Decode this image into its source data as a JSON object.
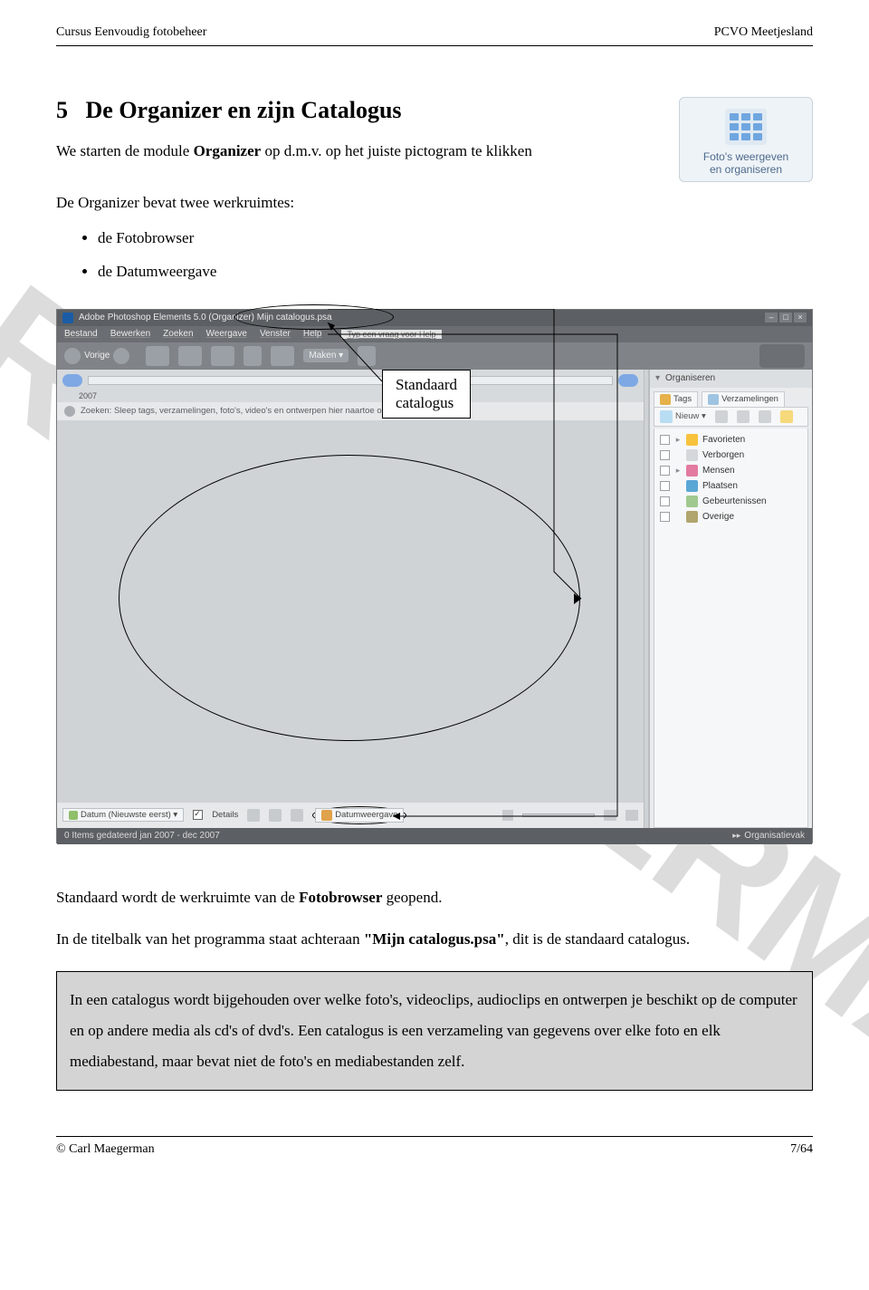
{
  "header": {
    "left": "Cursus Eenvoudig fotobeheer",
    "right": "PCVO Meetjesland"
  },
  "watermark": "CARL MAEGERMAN",
  "section": {
    "number": "5",
    "title": "De Organizer en zijn Catalogus",
    "intro_before": "We starten de module ",
    "intro_bold": "Organizer",
    "intro_after": " op d.m.v. op het juiste pictogram te klikken"
  },
  "icon_card": {
    "line1": "Foto's weergeven",
    "line2": "en organiseren"
  },
  "workspaces_intro": "De Organizer bevat twee werkruimtes:",
  "workspaces": [
    "de Fotobrowser",
    "de Datumweergave"
  ],
  "callout": {
    "line1": "Standaard",
    "line2": "catalogus"
  },
  "screenshot": {
    "title": "Adobe Photoshop Elements 5.0 (Organizer)   Mijn catalogus.psa",
    "window_buttons": [
      "–",
      "□",
      "×"
    ],
    "menus": [
      "Bestand",
      "Bewerken",
      "Zoeken",
      "Weergave",
      "Venster",
      "Help"
    ],
    "help_placeholder": "Typ een vraag voor Help",
    "nav_back_label": "Vorige",
    "maken_label": "Maken ▾",
    "year": "2007",
    "search_hint": "Zoeken: Sleep tags, verzamelingen, foto's, video's en ontwerpen hier naartoe om te zoeken.",
    "bottom": {
      "sort": "Datum (Nieuwste eerst) ▾",
      "details": "Details",
      "datumweergave": "Datumweergave"
    },
    "status_left": "0 Items gedateerd jan 2007 - dec 2007",
    "status_right": "Organisatievak",
    "sidepanel": {
      "header": "Organiseren",
      "tab_tags": "Tags",
      "tab_verz": "Verzamelingen",
      "nieuw": "Nieuw ▾",
      "tags": [
        "Favorieten",
        "Verborgen",
        "Mensen",
        "Plaatsen",
        "Gebeurtenissen",
        "Overige"
      ]
    }
  },
  "after": {
    "p1_before": "Standaard wordt de werkruimte van de ",
    "p1_bold": "Fotobrowser",
    "p1_after": " geopend.",
    "p2_before": "In de titelbalk van het programma staat achteraan ",
    "p2_bold": "\"Mijn catalogus.psa\"",
    "p2_after": ", dit is de standaard catalogus."
  },
  "greybox": "In een catalogus wordt bijgehouden over welke foto's, videoclips, audioclips en ontwerpen je beschikt op de computer en op andere media als cd's of dvd's. Een catalogus is een verzameling van gegevens over elke foto en elk mediabestand, maar bevat niet de foto's en mediabestanden zelf.",
  "footer": {
    "left": "© Carl Maegerman",
    "right": "7/64"
  }
}
